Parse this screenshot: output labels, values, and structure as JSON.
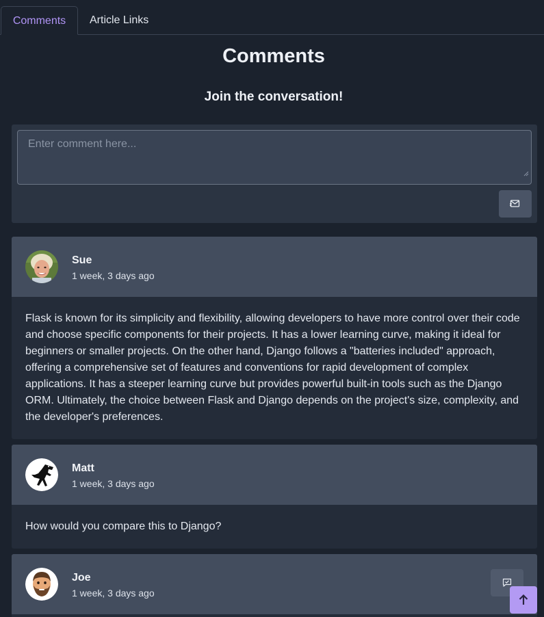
{
  "tabs": [
    {
      "label": "Comments",
      "active": true
    },
    {
      "label": "Article Links",
      "active": false
    }
  ],
  "title": "Comments",
  "subtitle": "Join the conversation!",
  "compose": {
    "placeholder": "Enter comment here...",
    "send_icon": "envelope-send-icon"
  },
  "comments": [
    {
      "author": "Sue",
      "time": "1 week, 3 days ago",
      "body": "Flask is known for its simplicity and flexibility, allowing developers to have more control over their code and choose specific components for their projects. It has a lower learning curve, making it ideal for beginners or smaller projects. On the other hand, Django follows a \"batteries included\" approach, offering a comprehensive set of features and conventions for rapid development of complex applications. It has a steeper learning curve but provides powerful built-in tools such as the Django ORM. Ultimately, the choice between Flask and Django depends on the project's size, complexity, and the developer's preferences."
    },
    {
      "author": "Matt",
      "time": "1 week, 3 days ago",
      "body": "How would you compare this to Django?"
    },
    {
      "author": "Joe",
      "time": "1 week, 3 days ago"
    }
  ],
  "colors": {
    "accent": "#b39af3",
    "background": "#1b222d",
    "card_header": "#434d5e"
  },
  "icons": {
    "reply": "reply-chat-icon",
    "scroll_top": "arrow-up-icon"
  }
}
